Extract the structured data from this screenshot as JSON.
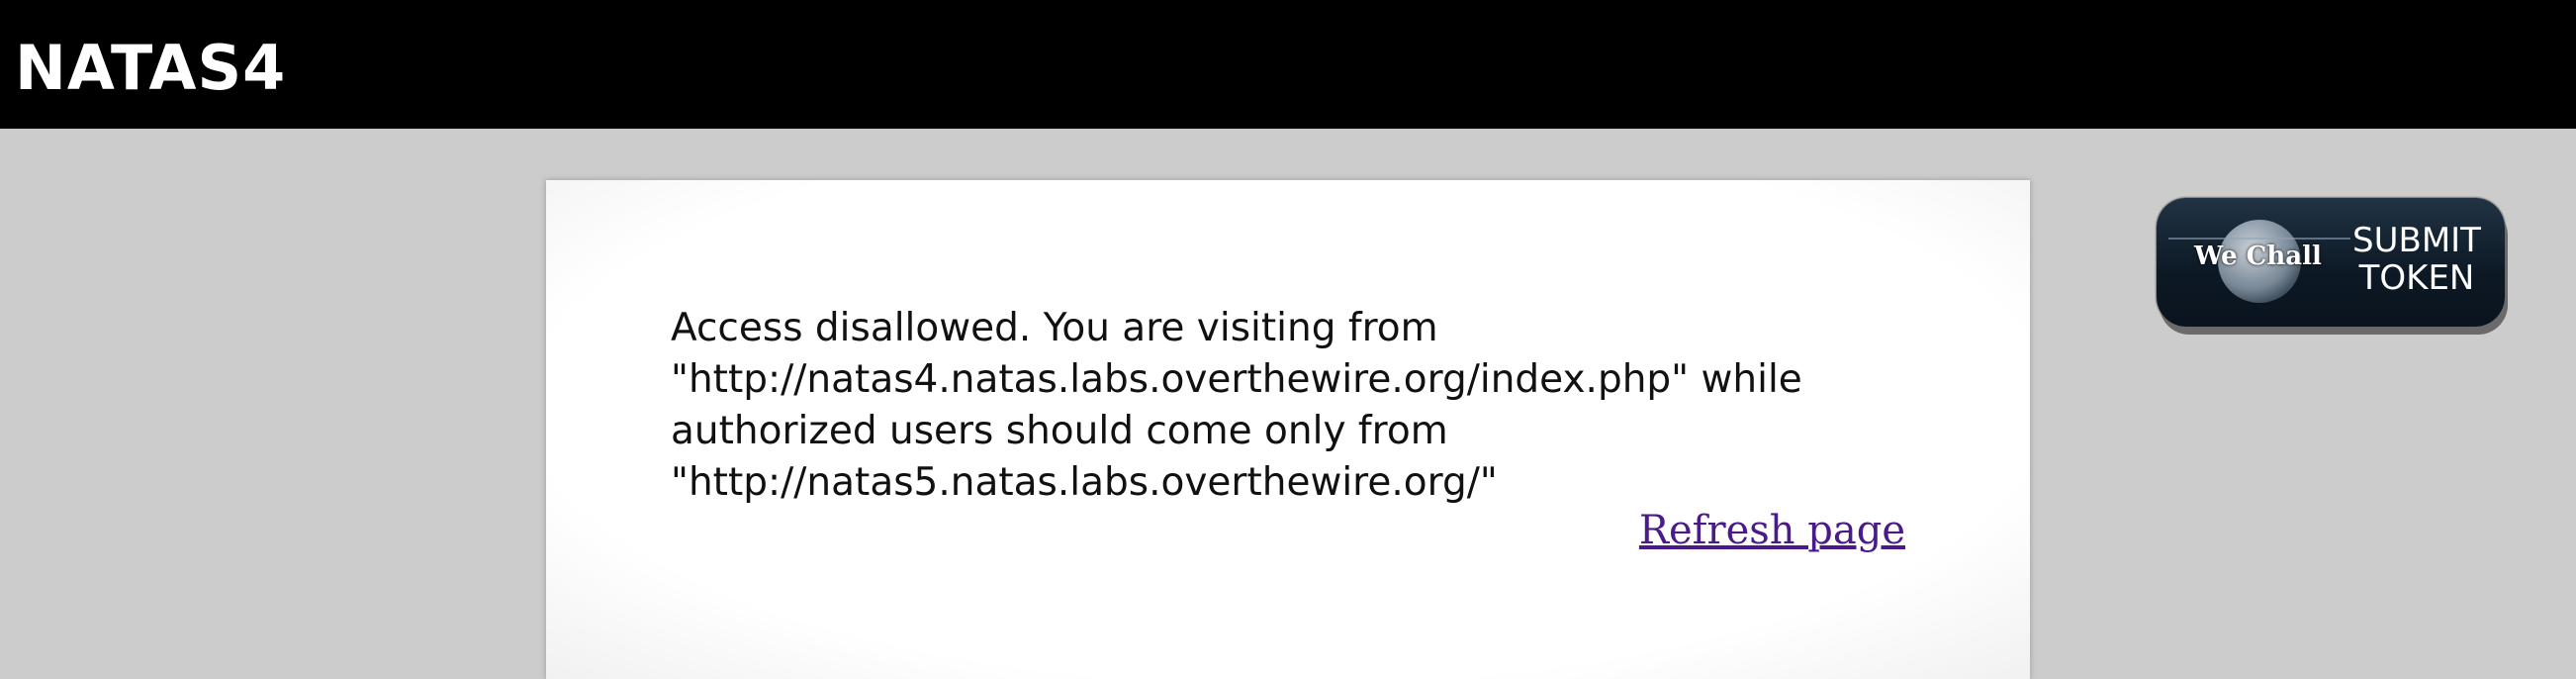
{
  "header": {
    "title": "NATAS4"
  },
  "content": {
    "message_lines": [
      "Access disallowed. You are visiting from",
      "\"http://natas4.natas.labs.overthewire.org/index.php\" while",
      "authorized users should come only from",
      "\"http://natas5.natas.labs.overthewire.org/\""
    ],
    "refresh_link": "Refresh page"
  },
  "wechall": {
    "logo_text": "We Chall",
    "button_line1": "SUBMIT",
    "button_line2": "TOKEN"
  },
  "colors": {
    "header_bg": "#000000",
    "page_bg": "#cccccc",
    "content_bg": "#ffffff",
    "link": "#4b1a8a",
    "wechall_bg": "#0c1824"
  }
}
